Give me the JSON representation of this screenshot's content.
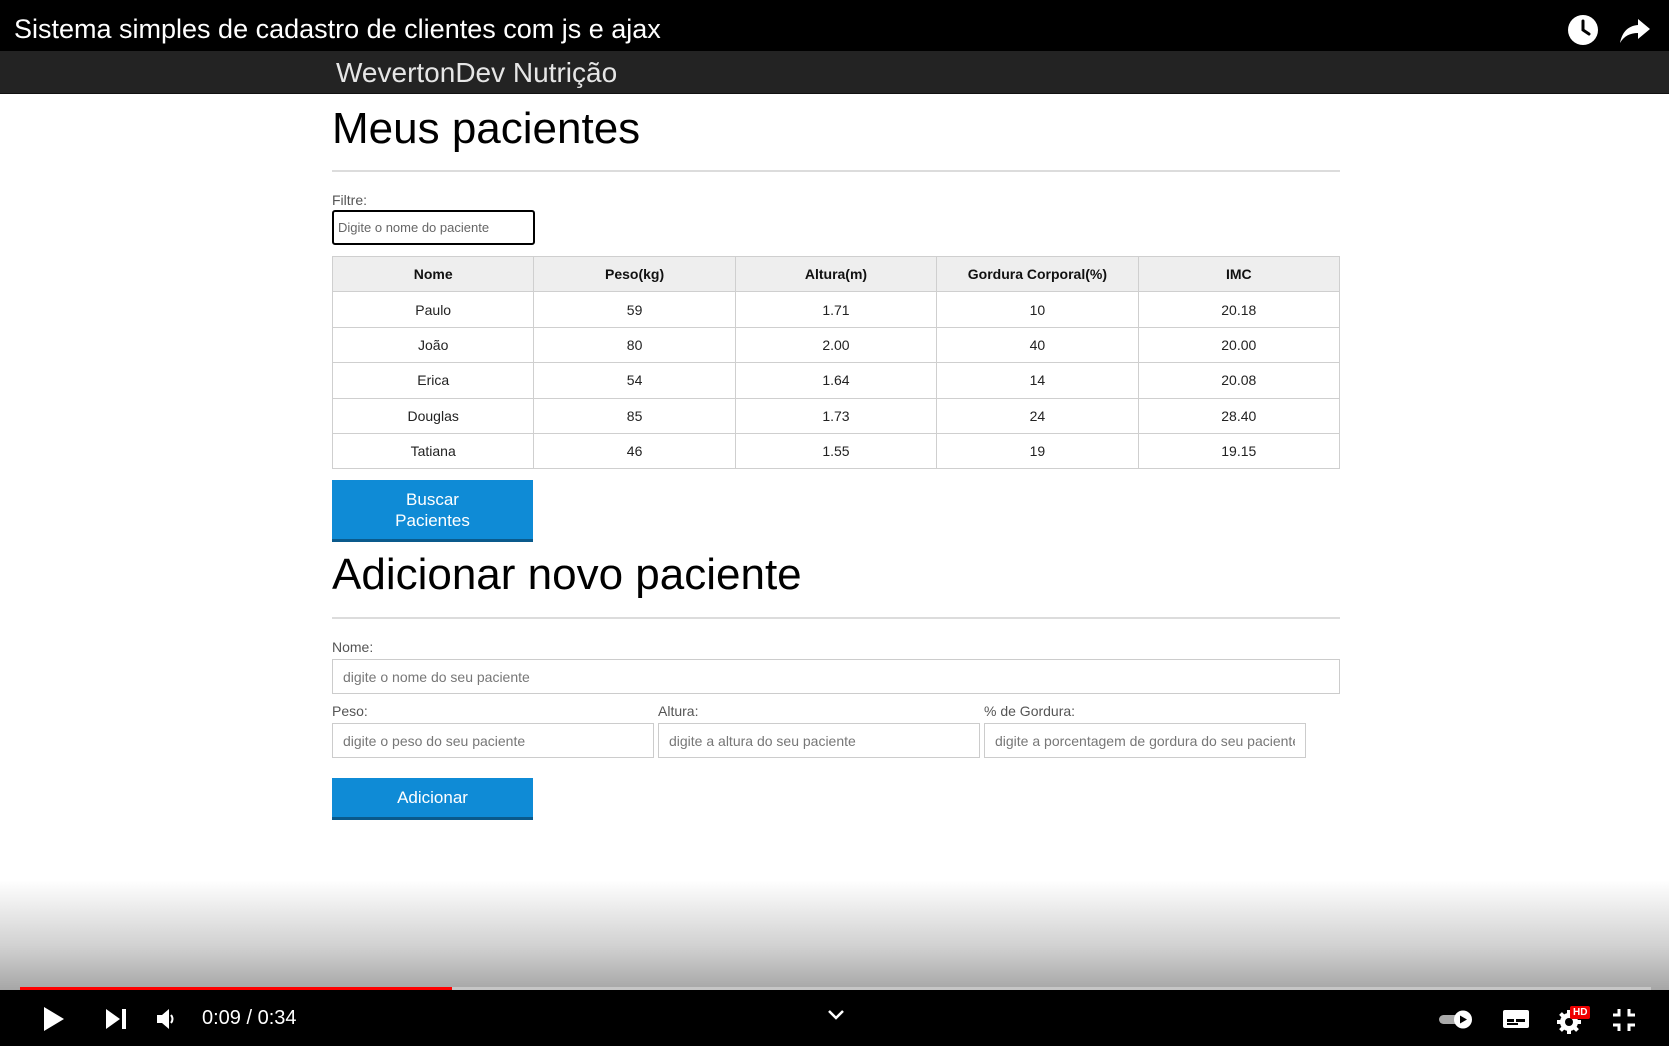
{
  "player": {
    "video_title": "Sistema simples de cadastro de clientes com js e ajax",
    "current_time": "0:09",
    "separator": "/",
    "duration": "0:34",
    "progress_fraction": 0.2647,
    "hd_badge": "HD",
    "accent_color": "#ff0000"
  },
  "app": {
    "logo": "WevertonDev Nutrição"
  },
  "patients_section": {
    "title": "Meus pacientes",
    "filter_label": "Filtre:",
    "filter_placeholder": "Digite o nome do paciente",
    "columns": [
      "Nome",
      "Peso(kg)",
      "Altura(m)",
      "Gordura Corporal(%)",
      "IMC"
    ],
    "rows": [
      [
        "Paulo",
        "59",
        "1.71",
        "10",
        "20.18"
      ],
      [
        "João",
        "80",
        "2.00",
        "40",
        "20.00"
      ],
      [
        "Erica",
        "54",
        "1.64",
        "14",
        "20.08"
      ],
      [
        "Douglas",
        "85",
        "1.73",
        "24",
        "28.40"
      ],
      [
        "Tatiana",
        "46",
        "1.55",
        "19",
        "19.15"
      ]
    ],
    "search_button_line1": "Buscar",
    "search_button_line2": "Pacientes"
  },
  "add_section": {
    "title": "Adicionar novo paciente",
    "name_label": "Nome:",
    "name_placeholder": "digite o nome do seu paciente",
    "weight_label": "Peso:",
    "weight_placeholder": "digite o peso do seu paciente",
    "height_label": "Altura:",
    "height_placeholder": "digite a altura do seu paciente",
    "fat_label": "% de Gordura:",
    "fat_placeholder": "digite a porcentagem de gordura do seu paciente",
    "add_button": "Adicionar"
  },
  "colors": {
    "button_blue": "#0f8bd6",
    "header_dark": "#232323"
  }
}
